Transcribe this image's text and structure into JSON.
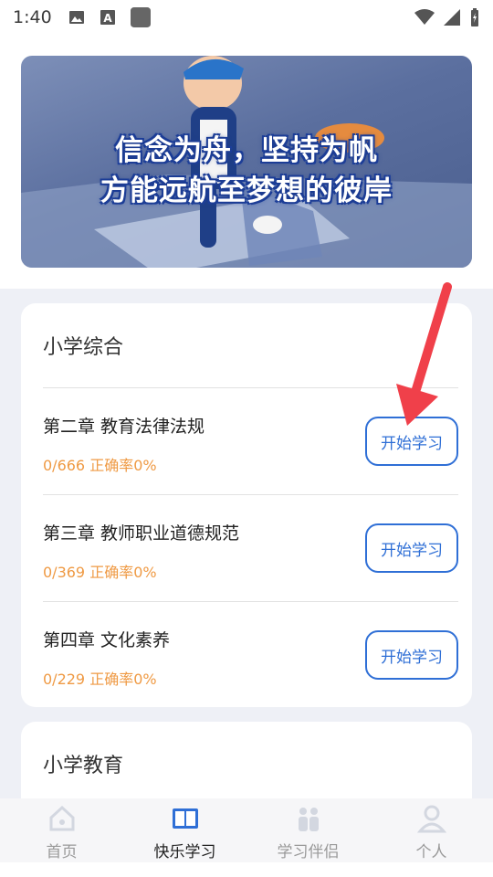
{
  "status_bar": {
    "time": "1:40"
  },
  "banner": {
    "line1": "信念为舟，坚持为帆",
    "line2": "方能远航至梦想的彼岸"
  },
  "sections": [
    {
      "title": "小学综合",
      "chapters": [
        {
          "name": "第二章 教育法律法规",
          "progress": "0/666 正确率0%",
          "button": "开始学习"
        },
        {
          "name": "第三章 教师职业道德规范",
          "progress": "0/369 正确率0%",
          "button": "开始学习"
        },
        {
          "name": "第四章 文化素养",
          "progress": "0/229 正确率0%",
          "button": "开始学习"
        }
      ]
    },
    {
      "title": "小学教育"
    }
  ],
  "nav": [
    {
      "label": "首页",
      "icon": "home-icon"
    },
    {
      "label": "快乐学习",
      "icon": "book-icon"
    },
    {
      "label": "学习伴侣",
      "icon": "partners-icon"
    },
    {
      "label": "个人",
      "icon": "user-icon"
    }
  ],
  "colors": {
    "accent": "#2f6fd6",
    "progress": "#ef9a44",
    "arrow": "#f0404a"
  }
}
